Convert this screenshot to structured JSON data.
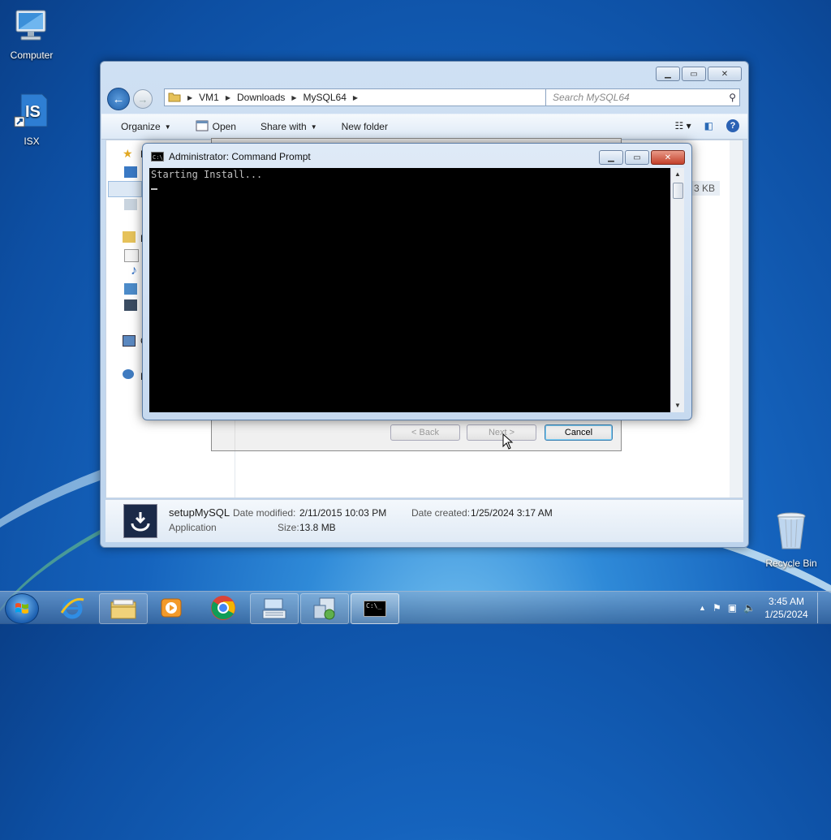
{
  "desktop": {
    "icons": [
      {
        "label": "Computer",
        "icon": "computer-icon"
      },
      {
        "label": "ISX",
        "icon": "isx-shortcut-icon"
      },
      {
        "label": "Recycle Bin",
        "icon": "recycle-bin-icon"
      }
    ]
  },
  "explorer": {
    "breadcrumb": [
      "VM1",
      "Downloads",
      "MySQL64"
    ],
    "search_placeholder": "Search MySQL64",
    "toolbar": {
      "organize": "Organize",
      "open": "Open",
      "share_with": "Share with",
      "new_folder": "New folder"
    },
    "nav_partial": [
      "F",
      "L",
      "C",
      "N"
    ],
    "file_size_partial": "3 KB",
    "details": {
      "name": "setupMySQL",
      "type": "Application",
      "date_modified_label": "Date modified:",
      "date_modified": "2/11/2015 10:03 PM",
      "date_created_label": "Date created:",
      "date_created": "1/25/2024 3:17 AM",
      "size_label": "Size:",
      "size": "13.8 MB"
    }
  },
  "installer": {
    "back": "< Back",
    "next": "Next >",
    "cancel": "Cancel"
  },
  "cmd": {
    "title": "Administrator:  Command Prompt",
    "output": "Starting Install..."
  },
  "taskbar": {
    "time": "3:45 AM",
    "date": "1/25/2024",
    "apps": [
      "file-explorer-icon",
      "internet-explorer-icon",
      "media-player-icon",
      "chrome-icon",
      "keyboard-app-icon",
      "installer-app-icon",
      "command-prompt-icon"
    ]
  }
}
